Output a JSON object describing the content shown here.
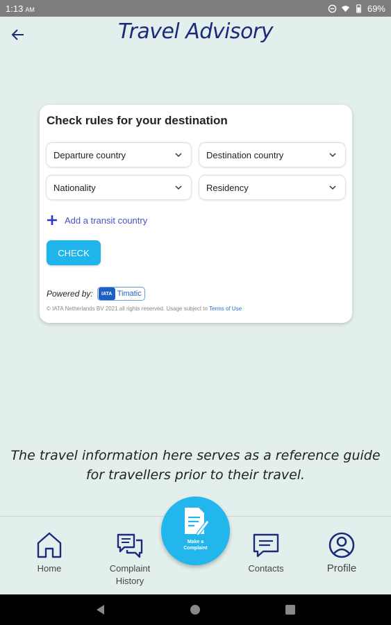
{
  "status_bar": {
    "time": "1:13",
    "ampm": "AM",
    "battery": "69%"
  },
  "app_bar": {
    "title": "Travel Advisory"
  },
  "card": {
    "title": "Check rules for your destination",
    "fields": {
      "departure": "Departure country",
      "destination": "Destination country",
      "nationality": "Nationality",
      "residency": "Residency"
    },
    "add_transit": "Add a transit country",
    "check_button": "CHECK",
    "powered_by": "Powered by:",
    "timatic_badge": "IATA",
    "timatic_label": "Timatic",
    "copyright": "© IATA Netherlands BV 2021 all rights reserved. Usage subject to",
    "terms_link": "Terms of Use"
  },
  "guide_text": {
    "line1": "The travel information here serves as a reference guide",
    "line2": "for travellers prior to their travel."
  },
  "bottom_nav": {
    "home": "Home",
    "complaint_history_1": "Complaint",
    "complaint_history_2": "History",
    "make_complaint": "Make a Complaint",
    "contacts": "Contacts",
    "profile": "Profile"
  },
  "colors": {
    "primary": "#1d2a7a",
    "accent": "#1fb5ea",
    "background": "#e3efec",
    "link": "#4a52c6"
  }
}
